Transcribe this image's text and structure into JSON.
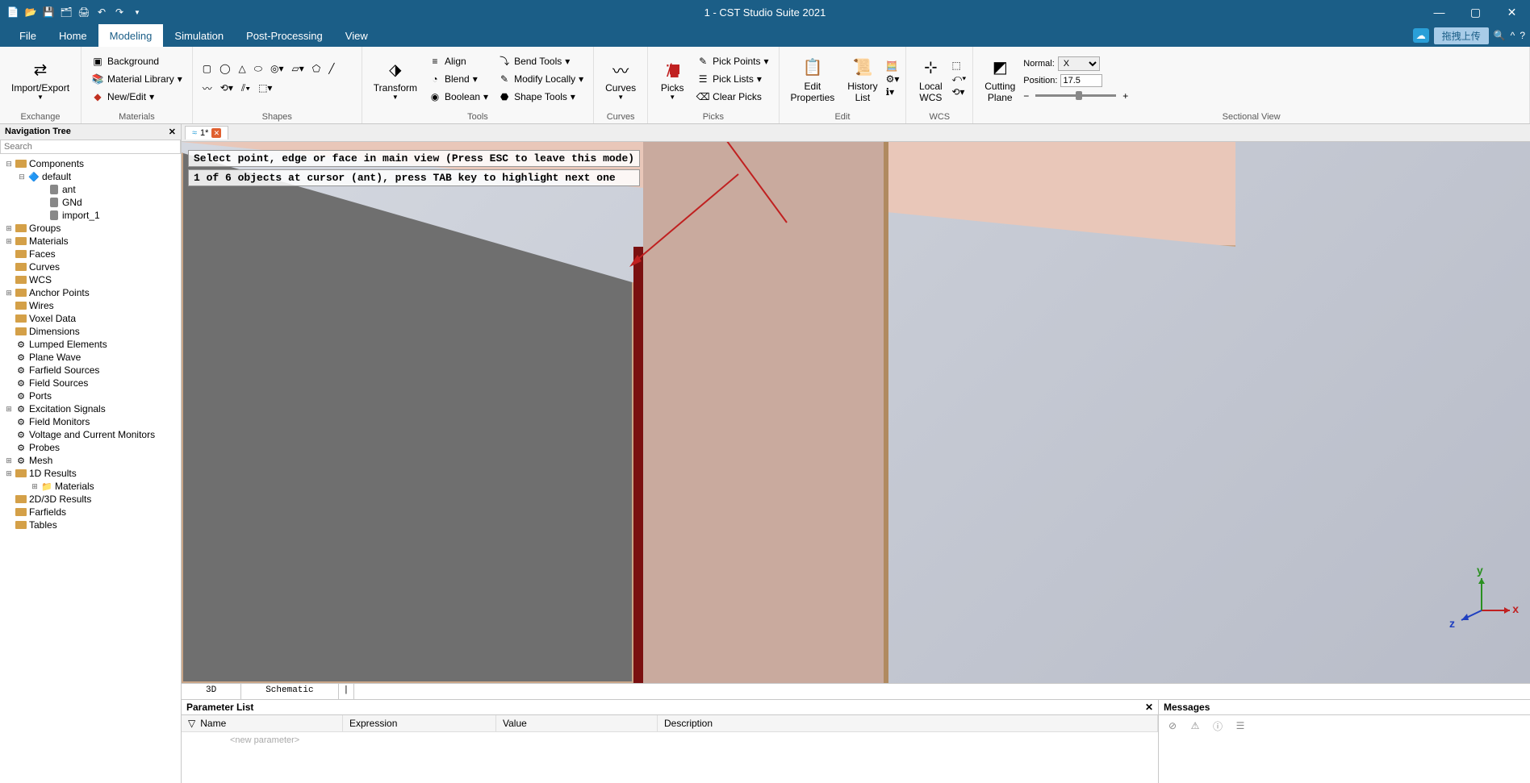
{
  "titlebar": {
    "title": "1 - CST Studio Suite 2021"
  },
  "menu": {
    "items": [
      "File",
      "Home",
      "Modeling",
      "Simulation",
      "Post-Processing",
      "View"
    ],
    "active_index": 2,
    "upload_label": "拖拽上传"
  },
  "ribbon": {
    "exchange": {
      "label": "Exchange",
      "import_export": "Import/Export"
    },
    "materials": {
      "label": "Materials",
      "background": "Background",
      "material_library": "Material Library",
      "new_edit": "New/Edit"
    },
    "shapes": {
      "label": "Shapes"
    },
    "tools": {
      "label": "Tools",
      "transform": "Transform",
      "align": "Align",
      "blend": "Blend",
      "boolean": "Boolean",
      "bend_tools": "Bend Tools",
      "modify_locally": "Modify Locally",
      "shape_tools": "Shape Tools"
    },
    "curves": {
      "label": "Curves",
      "btn": "Curves"
    },
    "picks": {
      "label": "Picks",
      "picks_btn": "Picks",
      "pick_points": "Pick Points",
      "pick_lists": "Pick Lists",
      "clear_picks": "Clear Picks"
    },
    "edit": {
      "label": "Edit",
      "properties": "Edit\nProperties",
      "history": "History\nList"
    },
    "wcs": {
      "label": "WCS",
      "local": "Local\nWCS"
    },
    "sectional": {
      "label": "Sectional View",
      "cutting": "Cutting\nPlane",
      "normal_label": "Normal:",
      "normal_value": "X",
      "position_label": "Position:",
      "position_value": "17.5"
    }
  },
  "nav": {
    "title": "Navigation Tree",
    "search_placeholder": "Search",
    "tree": {
      "components": "Components",
      "default": "default",
      "default_children": [
        "ant",
        "GNd",
        "import_1"
      ],
      "items": [
        "Groups",
        "Materials",
        "Faces",
        "Curves",
        "WCS",
        "Anchor Points",
        "Wires",
        "Voxel Data",
        "Dimensions",
        "Lumped Elements",
        "Plane Wave",
        "Farfield Sources",
        "Field Sources",
        "Ports",
        "Excitation Signals",
        "Field Monitors",
        "Voltage and Current Monitors",
        "Probes",
        "Mesh",
        "1D Results",
        "2D/3D Results",
        "Farfields",
        "Tables"
      ],
      "results_child": "Materials"
    }
  },
  "filetab": {
    "name": "1*"
  },
  "viewport": {
    "hint1": "Select point, edge or face in main view (Press ESC to leave this mode)",
    "hint2": "1 of 6 objects at cursor (ant), press TAB key to highlight next one",
    "axes": {
      "x": "x",
      "y": "y",
      "z": "z"
    }
  },
  "viewtabs": {
    "tab1": "3D",
    "tab2": "Schematic"
  },
  "paramlist": {
    "title": "Parameter List",
    "cols": {
      "name": "Name",
      "expr": "Expression",
      "val": "Value",
      "desc": "Description"
    },
    "new_placeholder": "<new parameter>"
  },
  "messages": {
    "title": "Messages"
  }
}
